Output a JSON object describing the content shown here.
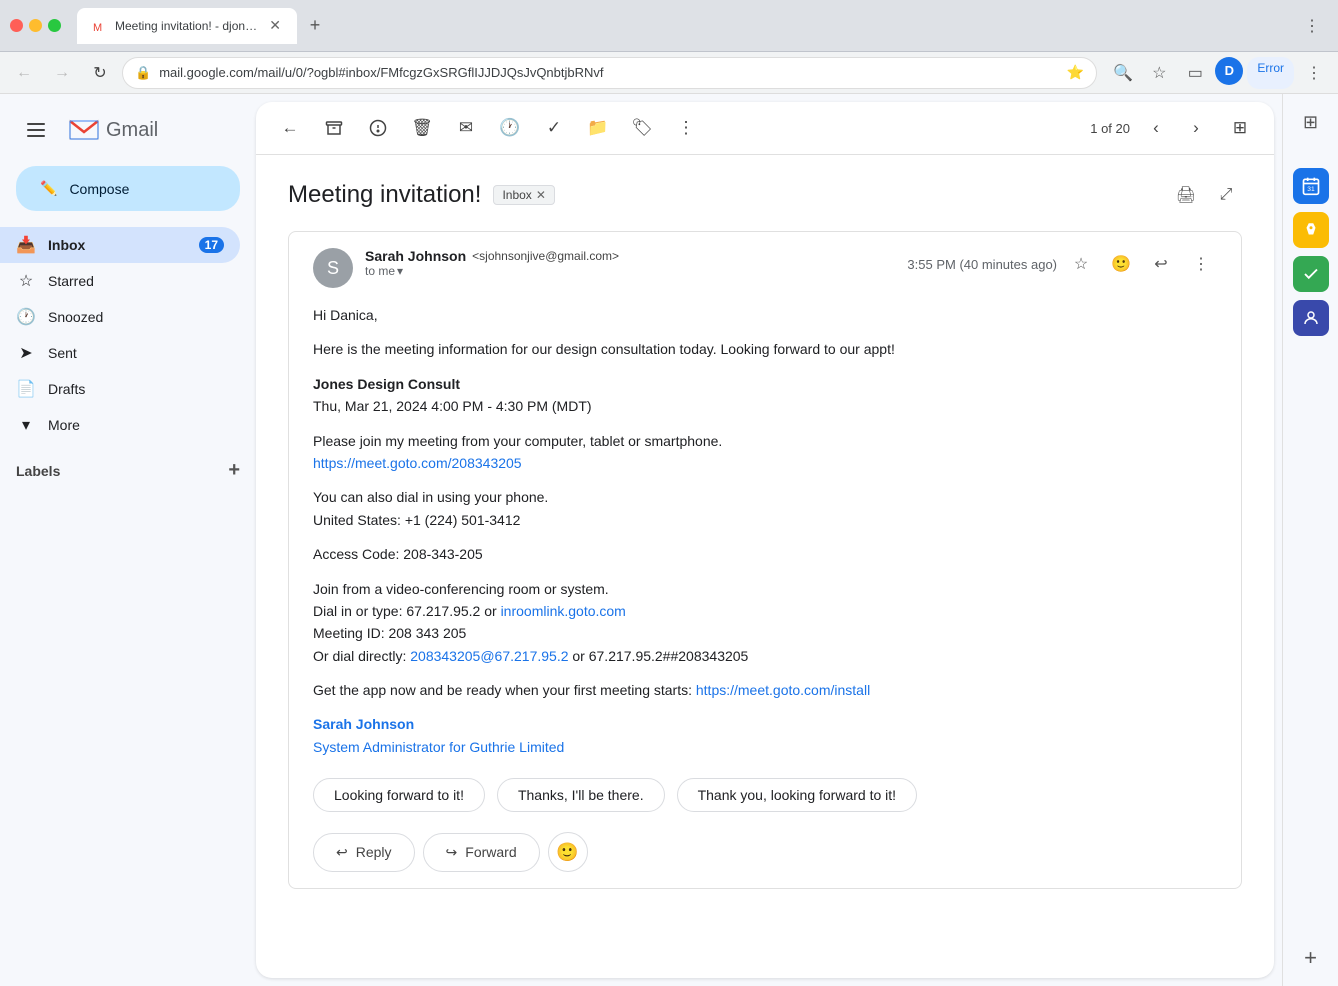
{
  "browser": {
    "tab_title": "Meeting invitation! - djones.g...",
    "address": "mail.google.com/mail/u/0/?ogbl#inbox/FMfcgzGxSRGflIJJDJQsJvQnbtjbRNvf",
    "new_tab_tooltip": "New tab",
    "error_badge": "Error"
  },
  "sidebar": {
    "compose_label": "Compose",
    "nav_items": [
      {
        "id": "inbox",
        "icon": "📥",
        "label": "Inbox",
        "badge": "17",
        "active": true
      },
      {
        "id": "starred",
        "icon": "☆",
        "label": "Starred",
        "badge": ""
      },
      {
        "id": "snoozed",
        "icon": "🕐",
        "label": "Snoozed",
        "badge": ""
      },
      {
        "id": "sent",
        "icon": "➤",
        "label": "Sent",
        "badge": ""
      },
      {
        "id": "drafts",
        "icon": "📄",
        "label": "Drafts",
        "badge": ""
      },
      {
        "id": "more",
        "icon": "▾",
        "label": "More",
        "badge": ""
      }
    ],
    "labels_header": "Labels",
    "labels_add_tooltip": "Create new label"
  },
  "toolbar": {
    "back_tooltip": "Back to Inbox",
    "archive_tooltip": "Archive",
    "report_spam_tooltip": "Report spam",
    "delete_tooltip": "Delete",
    "mark_unread_tooltip": "Mark as unread",
    "snooze_tooltip": "Snooze",
    "add_task_tooltip": "Add to tasks",
    "move_to_tooltip": "Move to",
    "label_as_tooltip": "Label as",
    "more_tooltip": "More",
    "page_counter": "1 of 20",
    "newer_tooltip": "Newer",
    "older_tooltip": "Older",
    "view_options_tooltip": "View options"
  },
  "email": {
    "subject": "Meeting invitation!",
    "inbox_tag": "Inbox",
    "sender_name": "Sarah Johnson",
    "sender_email": "<sjohnsonjive@gmail.com>",
    "to_me": "to me",
    "time": "3:55 PM (40 minutes ago)",
    "body_lines": [
      {
        "id": "greeting",
        "text": "Hi Danica,"
      },
      {
        "id": "intro",
        "text": "Here is the meeting information for our design consultation today. Looking forward to our appt!"
      },
      {
        "id": "blank1",
        "text": ""
      },
      {
        "id": "company",
        "text": "Jones Design Consult"
      },
      {
        "id": "datetime",
        "text": "Thu, Mar 21, 2024 4:00 PM - 4:30 PM (MDT)"
      },
      {
        "id": "blank2",
        "text": ""
      },
      {
        "id": "join_invite",
        "text": "Please join my meeting from your computer, tablet or smartphone."
      },
      {
        "id": "join_link",
        "text": "https://meet.goto.com/208343205",
        "is_link": true
      },
      {
        "id": "blank3",
        "text": ""
      },
      {
        "id": "dial_text",
        "text": "You can also dial in using your phone."
      },
      {
        "id": "us_number",
        "text": "United States: +1 (224) 501-3412"
      },
      {
        "id": "blank4",
        "text": ""
      },
      {
        "id": "access_code",
        "text": "Access Code: 208-343-205"
      },
      {
        "id": "blank5",
        "text": ""
      },
      {
        "id": "room_join",
        "text": "Join from a video-conferencing room or system."
      },
      {
        "id": "dial_type",
        "text": "Dial in or type: 67.217.95.2 or inroomlink.goto.com",
        "has_link": true,
        "link_text": "inroomlink.goto.com"
      },
      {
        "id": "meeting_id",
        "text": "Meeting ID: 208 343 205"
      },
      {
        "id": "dial_direct",
        "text": "Or dial directly: 208343205@67.217.95.2 or 67.217.95.2##208343205",
        "has_link": true,
        "link_text": "208343205@67.217.95.2"
      },
      {
        "id": "blank6",
        "text": ""
      },
      {
        "id": "app_link",
        "text": "Get the app now and be ready when your first meeting starts: https://meet.goto.com/install",
        "has_link": true,
        "link_text": "https://meet.goto.com/install"
      }
    ],
    "signature_name": "Sarah Johnson",
    "signature_title": "System Administrator for Guthrie Limited",
    "smart_replies": [
      "Looking forward to it!",
      "Thanks, I'll be there.",
      "Thank you, looking forward to it!"
    ],
    "reply_label": "Reply",
    "forward_label": "Forward"
  },
  "right_panel": {
    "icons": [
      {
        "id": "calendar",
        "symbol": "📅",
        "tooltip": "Google Calendar"
      },
      {
        "id": "keep",
        "symbol": "💛",
        "tooltip": "Google Keep"
      },
      {
        "id": "tasks",
        "symbol": "✓",
        "tooltip": "Google Tasks"
      },
      {
        "id": "contacts",
        "symbol": "👤",
        "tooltip": "Contacts"
      }
    ]
  }
}
